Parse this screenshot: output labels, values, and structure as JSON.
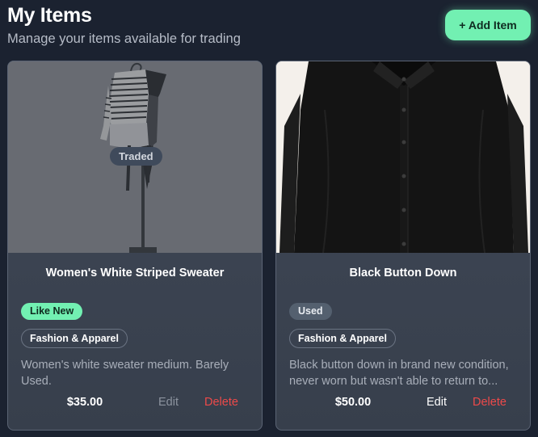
{
  "header": {
    "title": "My Items",
    "subtitle": "Manage your items available for trading",
    "add_button_label": "+ Add Item"
  },
  "items": [
    {
      "title": "Women's White Striped Sweater",
      "status_badge": "Traded",
      "condition": "Like New",
      "category": "Fashion & Apparel",
      "description": "Women's white sweater medium. Barely Used.",
      "price": "$35.00",
      "edit_label": "Edit",
      "delete_label": "Delete"
    },
    {
      "title": "Black Button Down",
      "condition": "Used",
      "category": "Fashion & Apparel",
      "description": "Black button down in brand new condition, never worn but wasn't able to return to...",
      "price": "$50.00",
      "edit_label": "Edit",
      "delete_label": "Delete"
    }
  ],
  "colors": {
    "background": "#1b2230",
    "accent": "#72f0b2",
    "danger": "#ee4a4a",
    "card": "#404857"
  }
}
